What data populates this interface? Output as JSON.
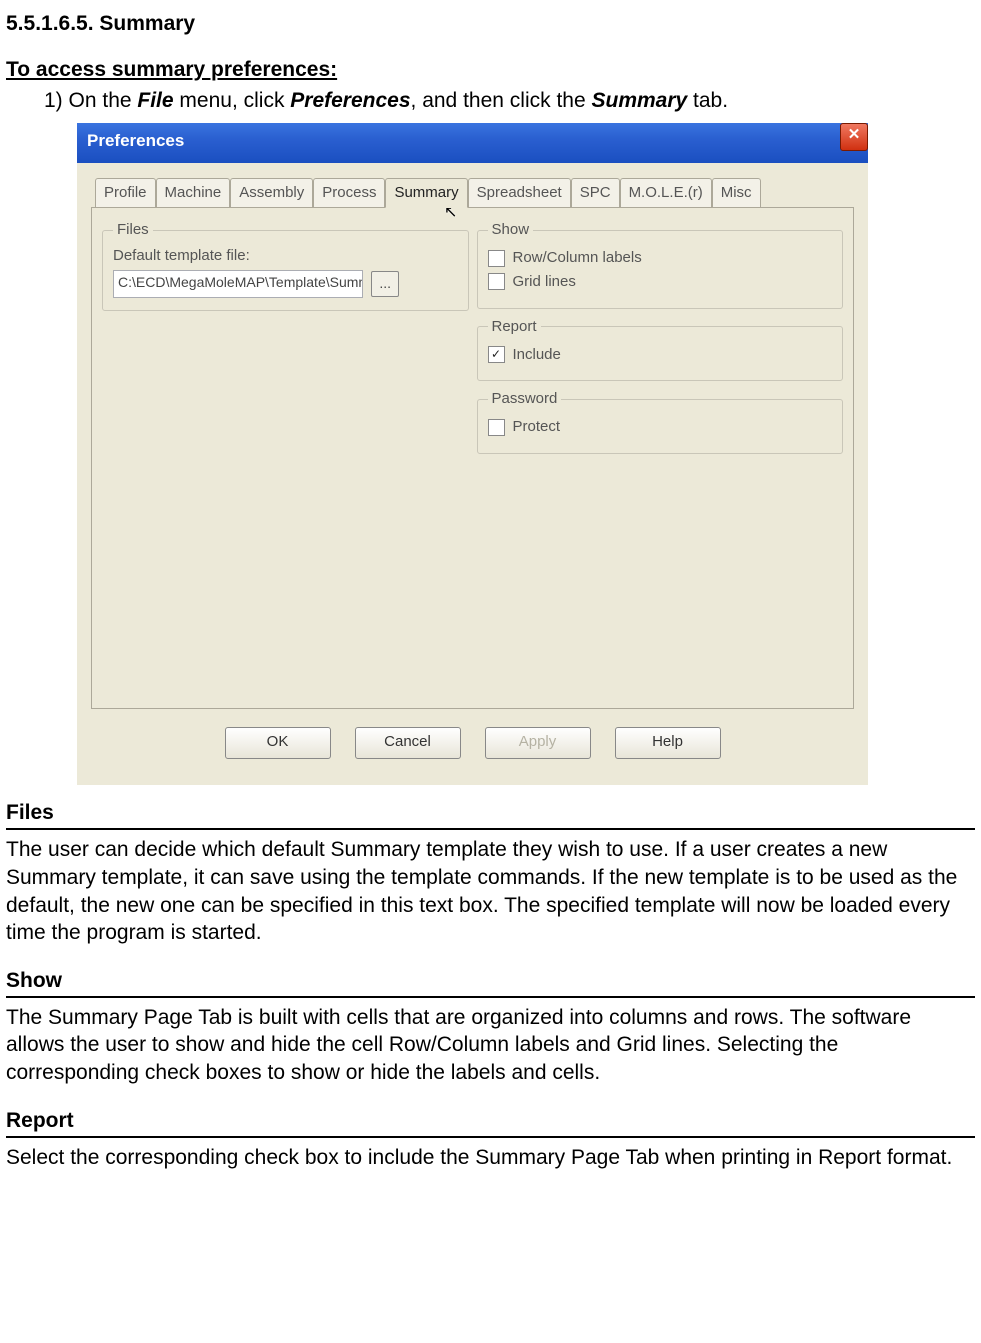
{
  "heading": "5.5.1.6.5. Summary",
  "access_heading": "To access summary preferences:",
  "step_prefix": "1) On the ",
  "step_mid1": " menu, click ",
  "step_mid2": ", and then click the ",
  "step_end": " tab.",
  "bold_file": "File",
  "bold_prefs": "Preferences",
  "bold_summary": "Summary",
  "dialog": {
    "title": "Preferences",
    "tabs": [
      "Profile",
      "Machine",
      "Assembly",
      "Process",
      "Summary",
      "Spreadsheet",
      "SPC",
      "M.O.L.E.(r)",
      "Misc"
    ],
    "files_legend": "Files",
    "files_label": "Default template file:",
    "files_value": "C:\\ECD\\MegaMoleMAP\\Template\\Summ",
    "browse": "...",
    "show_legend": "Show",
    "show_opt1": "Row/Column labels",
    "show_opt2": "Grid lines",
    "report_legend": "Report",
    "report_opt": "Include",
    "password_legend": "Password",
    "password_opt": "Protect",
    "btn_ok": "OK",
    "btn_cancel": "Cancel",
    "btn_apply": "Apply",
    "btn_help": "Help"
  },
  "sections": {
    "files_title": "Files",
    "files_body": "The user can decide which default Summary template they wish to use. If a user creates a new Summary template, it can save using the template commands. If the new template is to be used as the default, the new one can be specified in this text box. The specified template will now be loaded every time the program is started.",
    "show_title": "Show",
    "show_body": "The Summary Page Tab is built with cells that are organized into columns and rows. The software allows the user to show and hide the cell Row/Column labels and Grid lines. Selecting the corresponding check boxes to show or hide the labels and cells.",
    "report_title": "Report",
    "report_body": "Select the corresponding check box to include the Summary Page Tab when printing in Report format."
  }
}
